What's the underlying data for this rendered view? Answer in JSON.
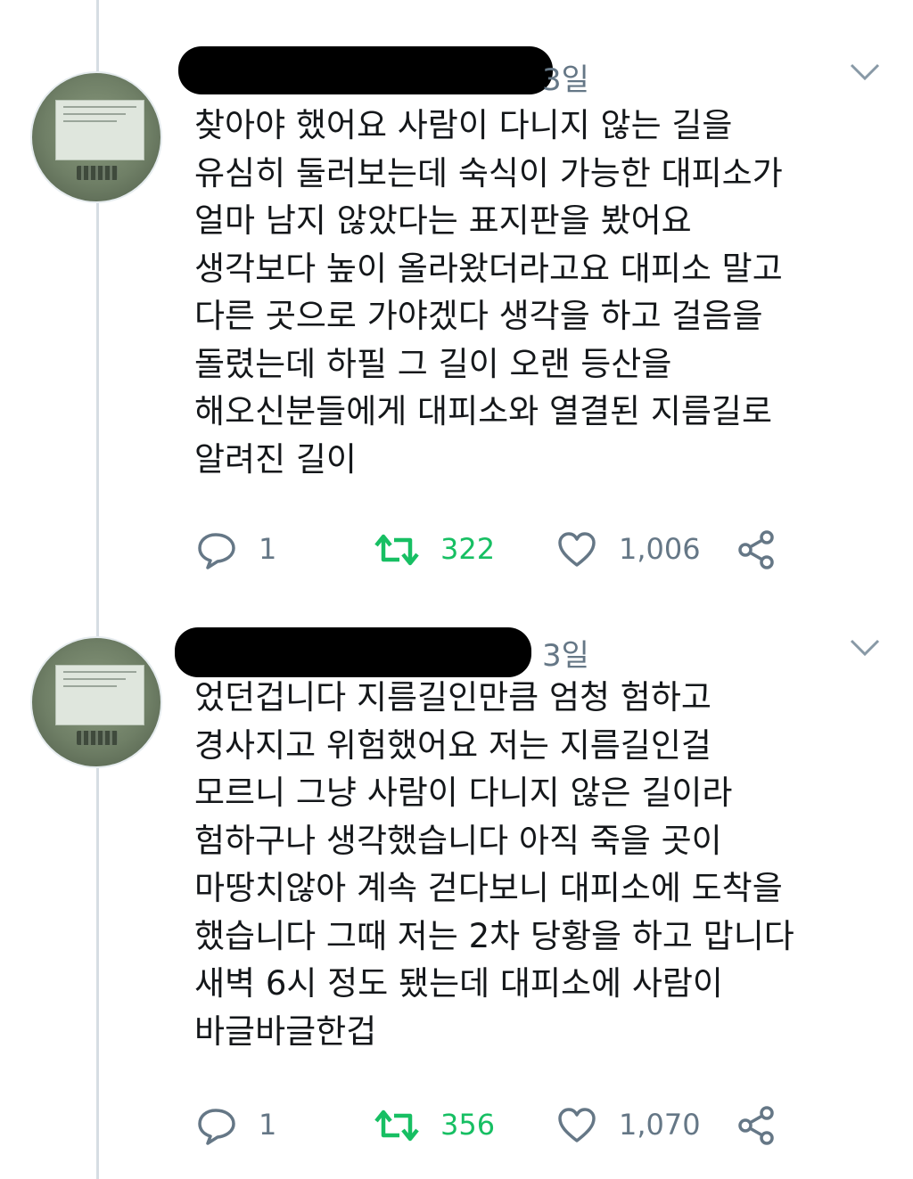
{
  "tweets": [
    {
      "time": "3일",
      "lines": [
        "찾아야 했어요 사람이 다니지 않는 길을",
        "유심히 둘러보는데 숙식이 가능한 대피소가",
        "얼마 남지 않았다는 표지판을 봤어요",
        "생각보다 높이 올라왔더라고요 대피소 말고",
        "다른 곳으로 가야겠다 생각을 하고 걸음을",
        "돌렸는데 하필 그 길이 오랜 등산을",
        "해오신분들에게 대피소와 열결된 지름길로",
        "알려진 길이"
      ],
      "replies": "1",
      "retweets": "322",
      "likes": "1,006"
    },
    {
      "time": "3일",
      "lines": [
        "었던겁니다 지름길인만큼 엄청 험하고",
        "경사지고 위험했어요 저는 지름길인걸",
        "모르니 그냥 사람이 다니지 않은 길이라",
        "험하구나 생각했습니다 아직 죽을 곳이",
        "마땅치않아 계속 걷다보니 대피소에 도착을",
        "했습니다 그때 저는 2차 당황을 하고 맙니다",
        "새벽 6시 정도 됐는데 대피소에 사람이",
        "바글바글한겁"
      ],
      "replies": "1",
      "retweets": "356",
      "likes": "1,070"
    }
  ],
  "icons": {
    "reply": "reply-icon",
    "retweet": "retweet-icon",
    "like": "heart-icon",
    "share": "share-icon",
    "menu": "chevron-down-icon"
  },
  "colors": {
    "text": "#14171a",
    "muted": "#657786",
    "retweet": "#17bf63",
    "thread_line": "#d6dde3"
  }
}
